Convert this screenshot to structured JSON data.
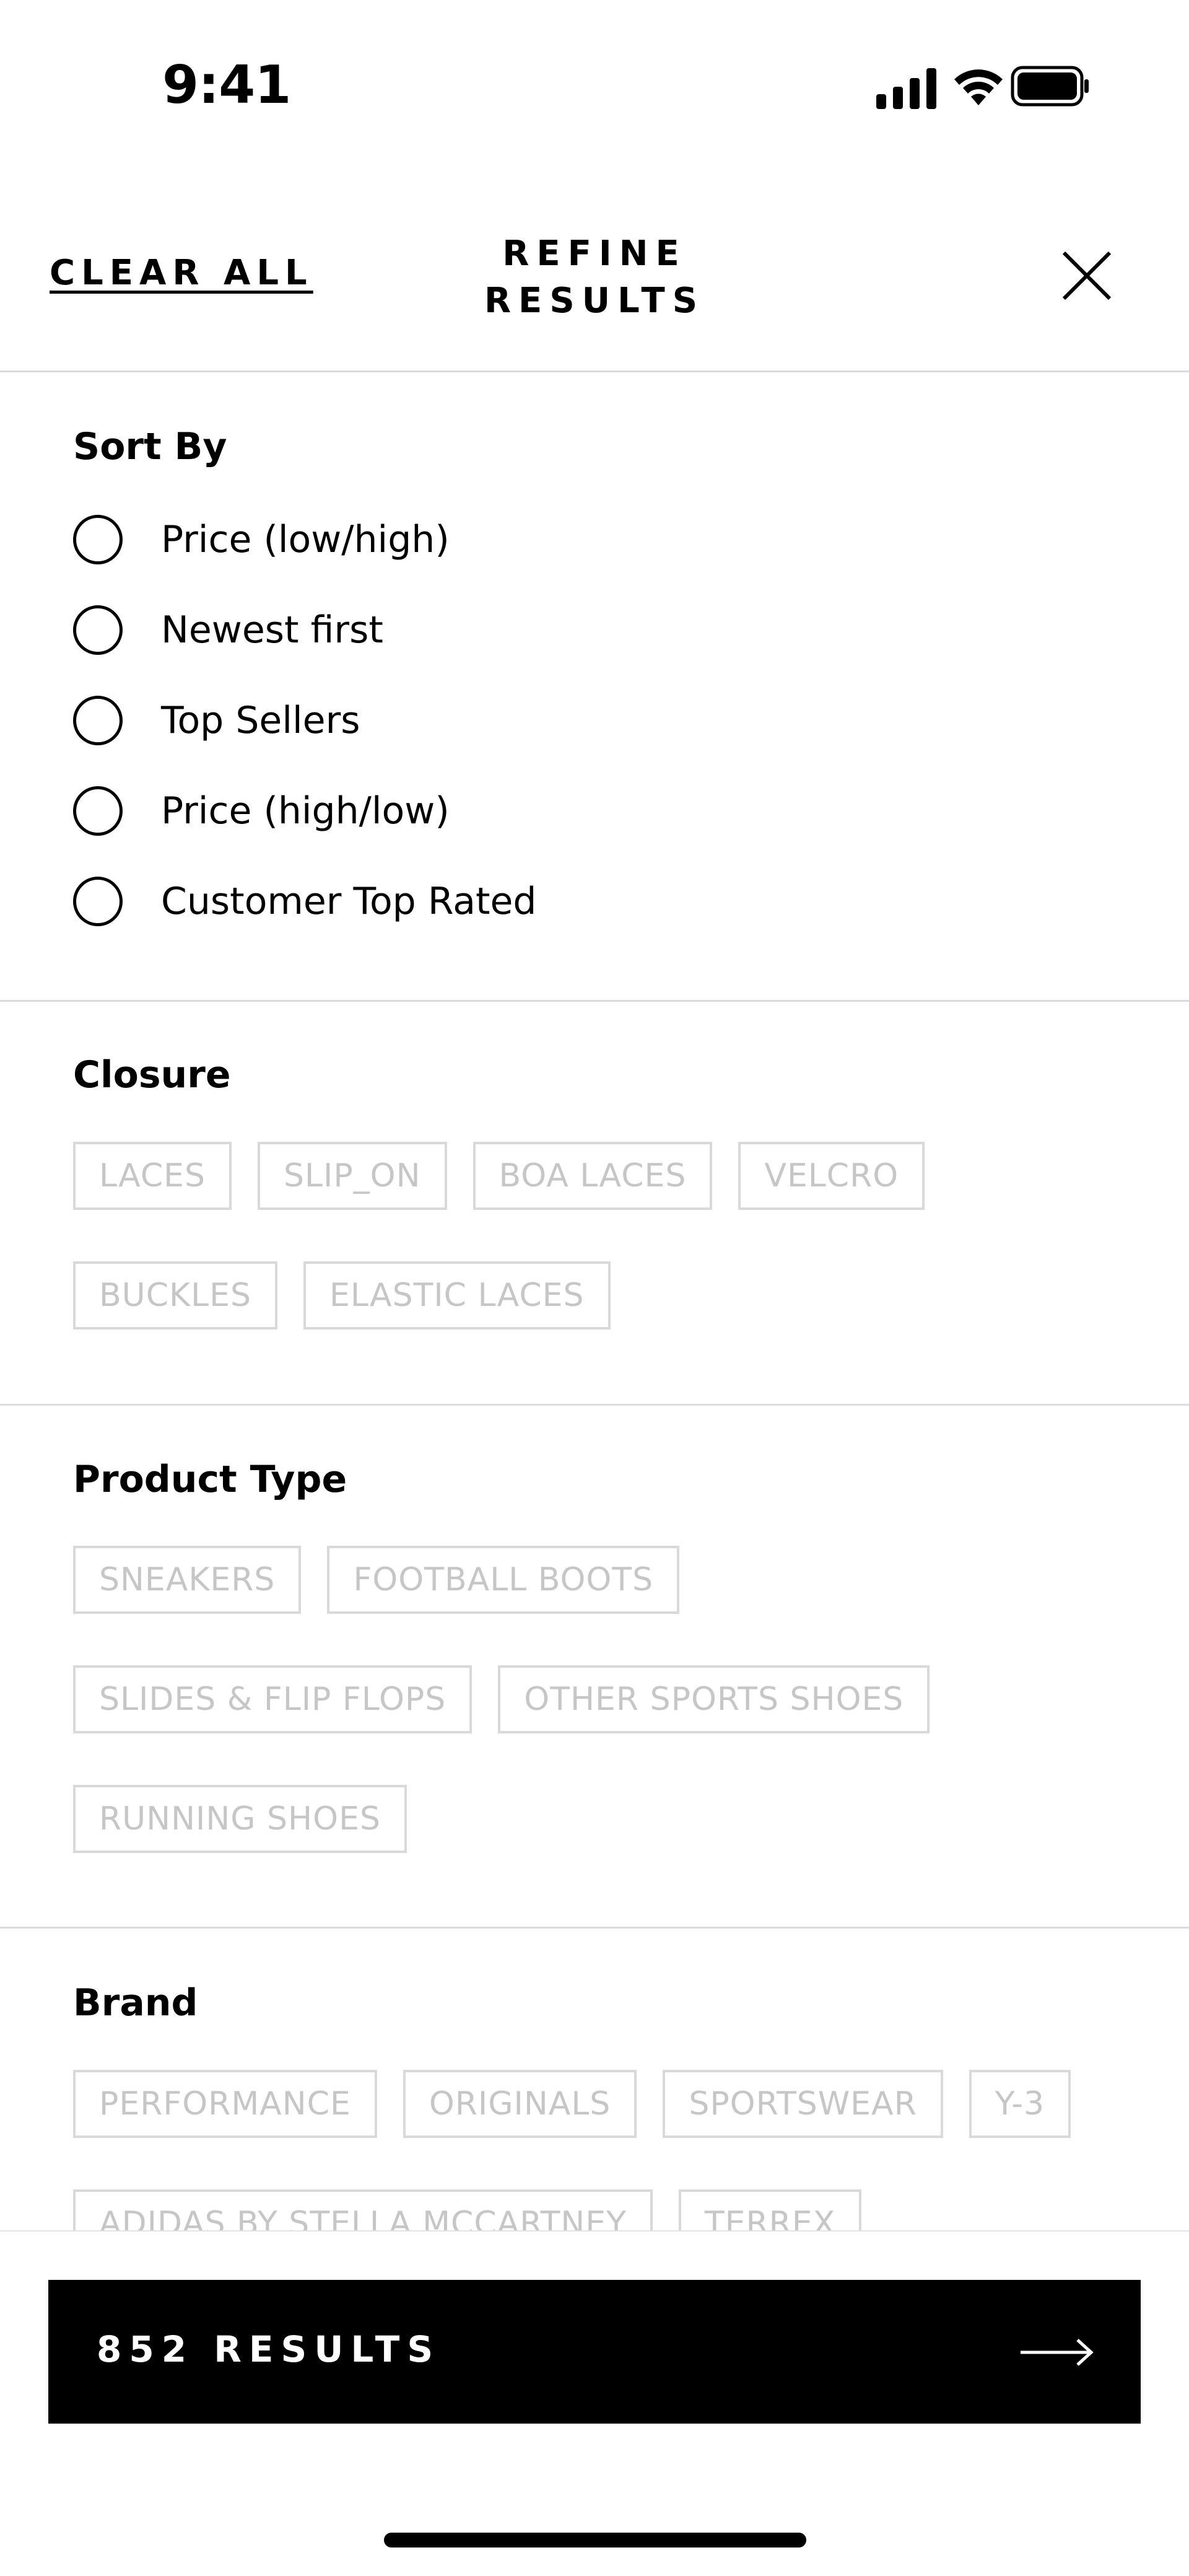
{
  "status_bar": {
    "time": "9:41",
    "icons": [
      "cellular-signal-icon",
      "wifi-icon",
      "battery-icon"
    ]
  },
  "header": {
    "clear_all": "CLEAR ALL",
    "title_line1": "REFINE",
    "title_line2": "RESULTS",
    "close_icon": "close-icon"
  },
  "sort_by": {
    "title": "Sort By",
    "options": [
      "Price (low/high)",
      "Newest first",
      "Top Sellers",
      "Price (high/low)",
      "Customer Top Rated"
    ]
  },
  "closure": {
    "title": "Closure",
    "chips": [
      "LACES",
      "SLIP_ON",
      "BOA LACES",
      "VELCRO",
      "BUCKLES",
      "ELASTIC LACES"
    ]
  },
  "product_type": {
    "title": "Product Type",
    "chips": [
      "SNEAKERS",
      "FOOTBALL BOOTS",
      "SLIDES & FLIP FLOPS",
      "OTHER SPORTS SHOES",
      "RUNNING SHOES"
    ]
  },
  "brand": {
    "title": "Brand",
    "chips": [
      "PERFORMANCE",
      "ORIGINALS",
      "SPORTSWEAR",
      "Y-3",
      "ADIDAS BY STELLA MCCARTNEY",
      "TERREX"
    ]
  },
  "footer": {
    "results_label": "852 RESULTS",
    "arrow_icon": "arrow-right-icon"
  },
  "colors": {
    "chip_border": "#d9d9d9",
    "chip_text": "#c6c6c6",
    "button_bg": "#000000",
    "divider": "#dcdcdc"
  }
}
